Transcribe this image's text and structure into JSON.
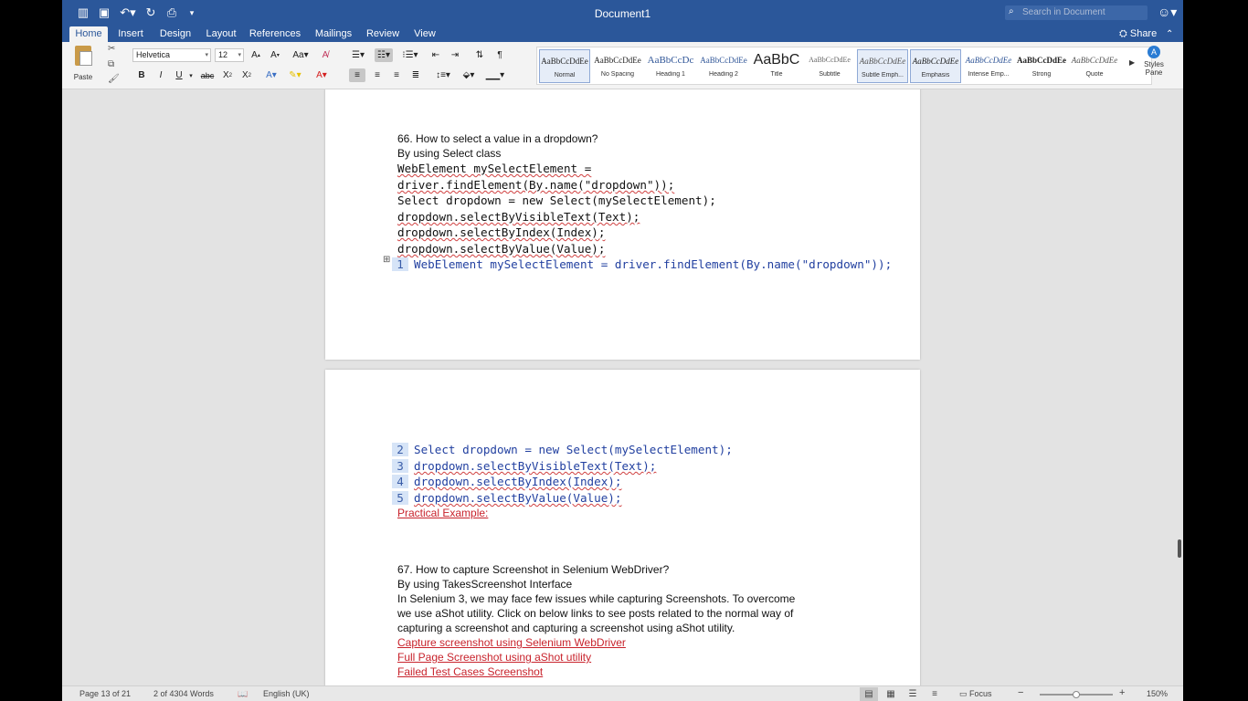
{
  "titlebar": {
    "title": "Document1",
    "search_placeholder": "Search in Document"
  },
  "tabs": [
    {
      "label": "Home"
    },
    {
      "label": "Insert"
    },
    {
      "label": "Design"
    },
    {
      "label": "Layout"
    },
    {
      "label": "References"
    },
    {
      "label": "Mailings"
    },
    {
      "label": "Review"
    },
    {
      "label": "View"
    }
  ],
  "share_label": "Share",
  "ribbon": {
    "paste_label": "Paste",
    "font_name": "Helvetica",
    "font_size": "12",
    "styles": [
      {
        "sample": "AaBbCcDdEe",
        "name": "Normal"
      },
      {
        "sample": "AaBbCcDdEe",
        "name": "No Spacing"
      },
      {
        "sample": "AaBbCcDc",
        "name": "Heading 1"
      },
      {
        "sample": "AaBbCcDdEe",
        "name": "Heading 2"
      },
      {
        "sample": "AaBbC",
        "name": "Title"
      },
      {
        "sample": "AaBbCcDdEe",
        "name": "Subtitle"
      },
      {
        "sample": "AaBbCcDdEe",
        "name": "Subtle Emph..."
      },
      {
        "sample": "AaBbCcDdEe",
        "name": "Emphasis"
      },
      {
        "sample": "AaBbCcDdEe",
        "name": "Intense Emp..."
      },
      {
        "sample": "AaBbCcDdEe",
        "name": "Strong"
      },
      {
        "sample": "AaBbCcDdEe",
        "name": "Quote"
      }
    ],
    "styles_pane_label": "Styles Pane"
  },
  "document": {
    "page1": {
      "q66": "66. How to select a value in a dropdown?",
      "q66_answer": "By using Select class",
      "code": [
        "WebElement mySelectElement =",
        "driver.findElement(By.name(\"dropdown\"));",
        "Select dropdown = new Select(mySelectElement);",
        "dropdown.selectByVisibleText(Text);",
        "dropdown.selectByIndex(Index);",
        "dropdown.selectByValue(Value);"
      ],
      "numbered_line_1": {
        "num": "1",
        "text": "WebElement mySelectElement = driver.findElement(By.name(\"dropdown\"));"
      }
    },
    "page2": {
      "numbered_lines": [
        {
          "num": "2",
          "text": "Select dropdown = new Select(mySelectElement);"
        },
        {
          "num": "3",
          "text": "dropdown.selectByVisibleText(Text);"
        },
        {
          "num": "4",
          "text": "dropdown.selectByIndex(Index);"
        },
        {
          "num": "5",
          "text": "dropdown.selectByValue(Value);"
        }
      ],
      "practical_example": "Practical Example:",
      "q67": "67. How to capture Screenshot in Selenium WebDriver?",
      "q67_answer": "By using TakesScreenshot Interface",
      "para": [
        "In Selenium 3, we may face few issues while capturing Screenshots. To overcome",
        "we use aShot utility. Click on below links to see posts related to the normal way of",
        "capturing a screenshot and capturing a screenshot using aShot utility."
      ],
      "links": [
        "Capture screenshot using Selenium WebDriver",
        "Full Page Screenshot using aShot utility",
        "Failed Test Cases Screenshot"
      ]
    }
  },
  "statusbar": {
    "page": "Page 13 of 21",
    "words": "2 of 4304 Words",
    "language": "English (UK)",
    "focus": "Focus",
    "zoom": "150%",
    "zoom_fraction": 0.5
  }
}
